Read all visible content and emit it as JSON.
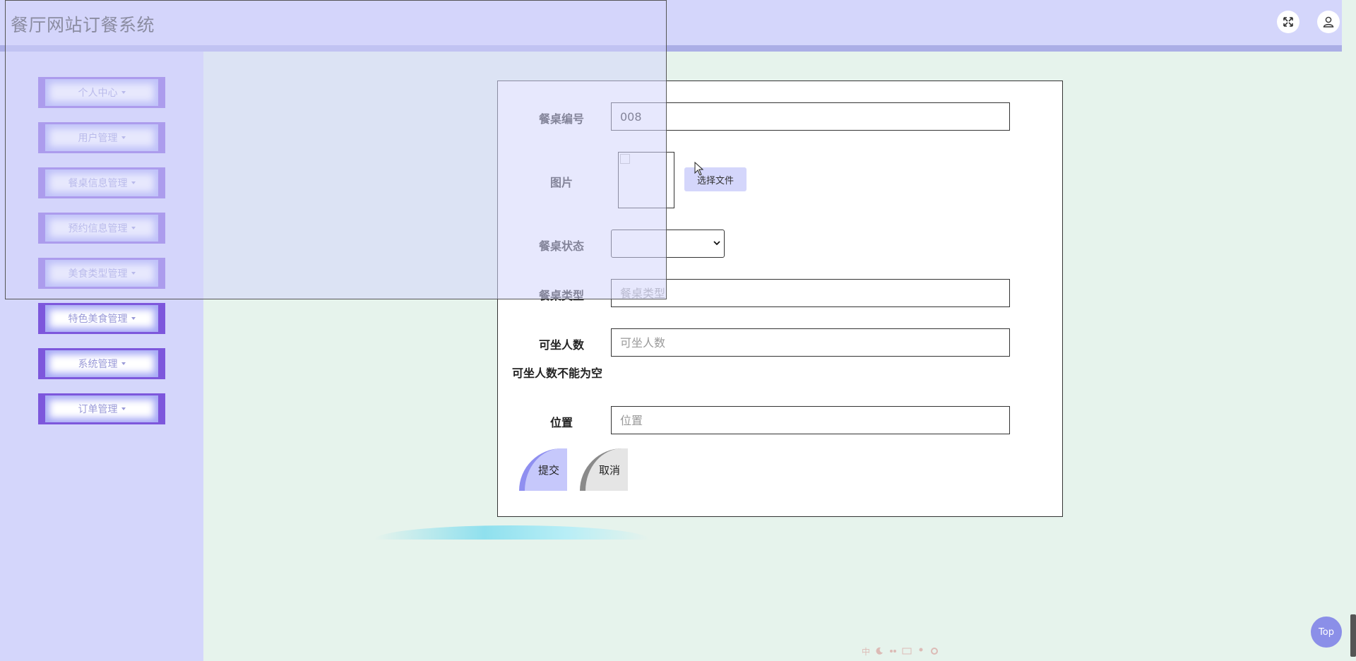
{
  "app": {
    "title": "餐厅网站订餐系统"
  },
  "header": {
    "fullscreen_icon": "expand-icon",
    "user_icon": "user-icon"
  },
  "sidebar": {
    "items": [
      {
        "label": "个人中心"
      },
      {
        "label": "用户管理"
      },
      {
        "label": "餐桌信息管理"
      },
      {
        "label": "预约信息管理"
      },
      {
        "label": "美食类型管理"
      },
      {
        "label": "特色美食管理"
      },
      {
        "label": "系统管理"
      },
      {
        "label": "订单管理"
      }
    ]
  },
  "form": {
    "table_no": {
      "label": "餐桌编号",
      "value": "008"
    },
    "image": {
      "label": "图片",
      "button": "选择文件"
    },
    "status": {
      "label": "餐桌状态",
      "value": ""
    },
    "type": {
      "label": "餐桌类型",
      "placeholder": "餐桌类型"
    },
    "seats": {
      "label": "可坐人数",
      "placeholder": "可坐人数",
      "error": "可坐人数不能为空"
    },
    "location": {
      "label": "位置",
      "placeholder": "位置"
    },
    "submit_label": "提交",
    "cancel_label": "取消"
  },
  "misc": {
    "top_label": "Top",
    "ime_chars": "中"
  },
  "colors": {
    "accent": "#7d57dc",
    "header_bg": "#d4d6fb",
    "main_bg": "#e6f3ec"
  }
}
